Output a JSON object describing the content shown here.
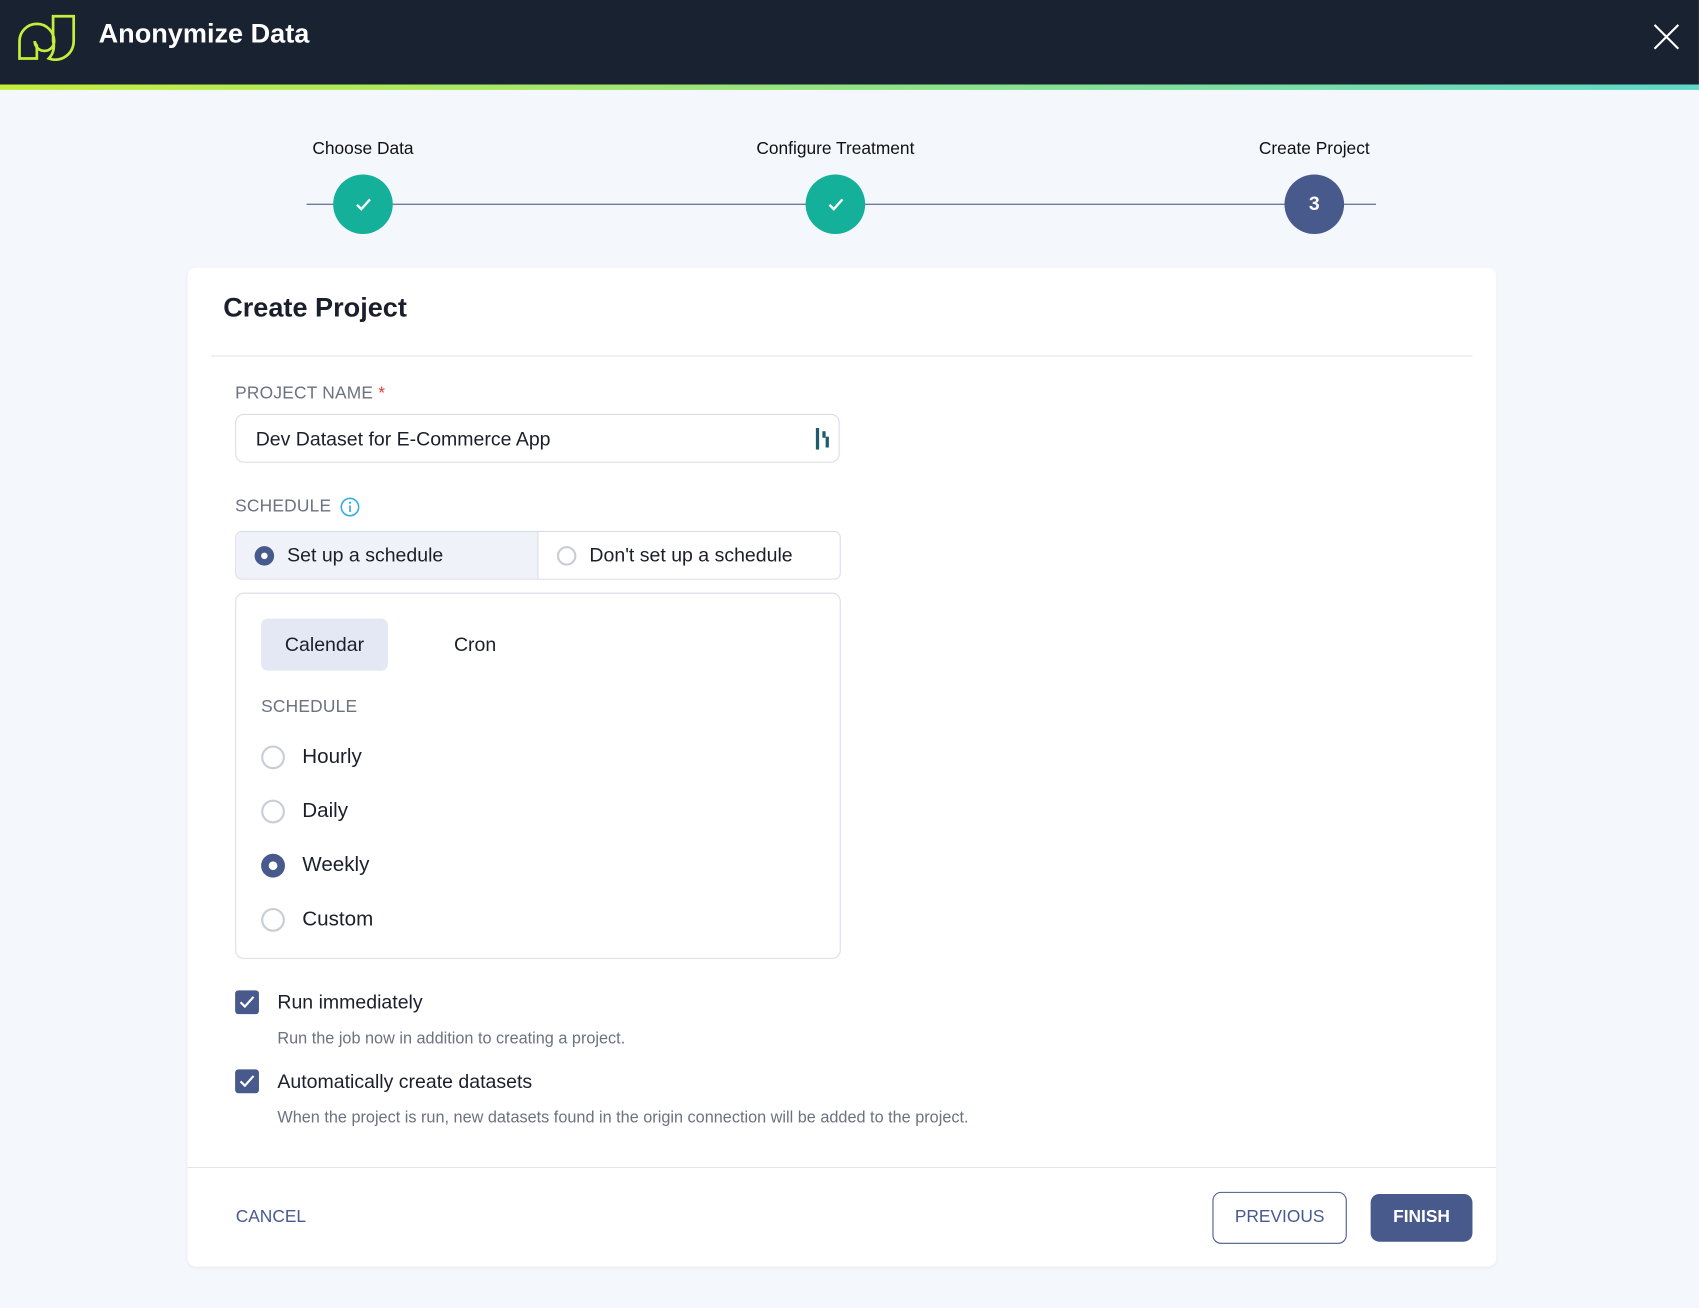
{
  "header": {
    "title": "Anonymize Data",
    "logo_icon": "logo-icon",
    "close_icon": "close-icon"
  },
  "stepper": {
    "steps": [
      {
        "label": "Choose Data",
        "status": "complete"
      },
      {
        "label": "Configure Treatment",
        "status": "complete"
      },
      {
        "label": "Create Project",
        "status": "current",
        "number": "3"
      }
    ]
  },
  "form": {
    "title": "Create Project",
    "project_name": {
      "label": "PROJECT NAME",
      "required_mark": "*",
      "value": "Dev Dataset for E-Commerce App"
    },
    "schedule": {
      "label": "SCHEDULE",
      "options": [
        "Set up a schedule",
        "Don't set up a schedule"
      ],
      "selected": "Set up a schedule",
      "tabs": [
        "Calendar",
        "Cron"
      ],
      "active_tab": "Calendar",
      "frequency_label": "SCHEDULE",
      "frequencies": [
        "Hourly",
        "Daily",
        "Weekly",
        "Custom"
      ],
      "selected_frequency": "Weekly"
    },
    "run_immediately": {
      "label": "Run immediately",
      "checked": true,
      "help": "Run the job now in addition to creating a project."
    },
    "auto_create": {
      "label": "Automatically create datasets",
      "checked": true,
      "help": "When the project is run, new datasets found in the origin connection will be added to the project."
    }
  },
  "footer": {
    "cancel": "CANCEL",
    "previous": "PREVIOUS",
    "finish": "FINISH"
  },
  "colors": {
    "header_bg": "#182230",
    "primary": "#485a8c",
    "success": "#14b09a",
    "lime": "#c4ee3c"
  }
}
